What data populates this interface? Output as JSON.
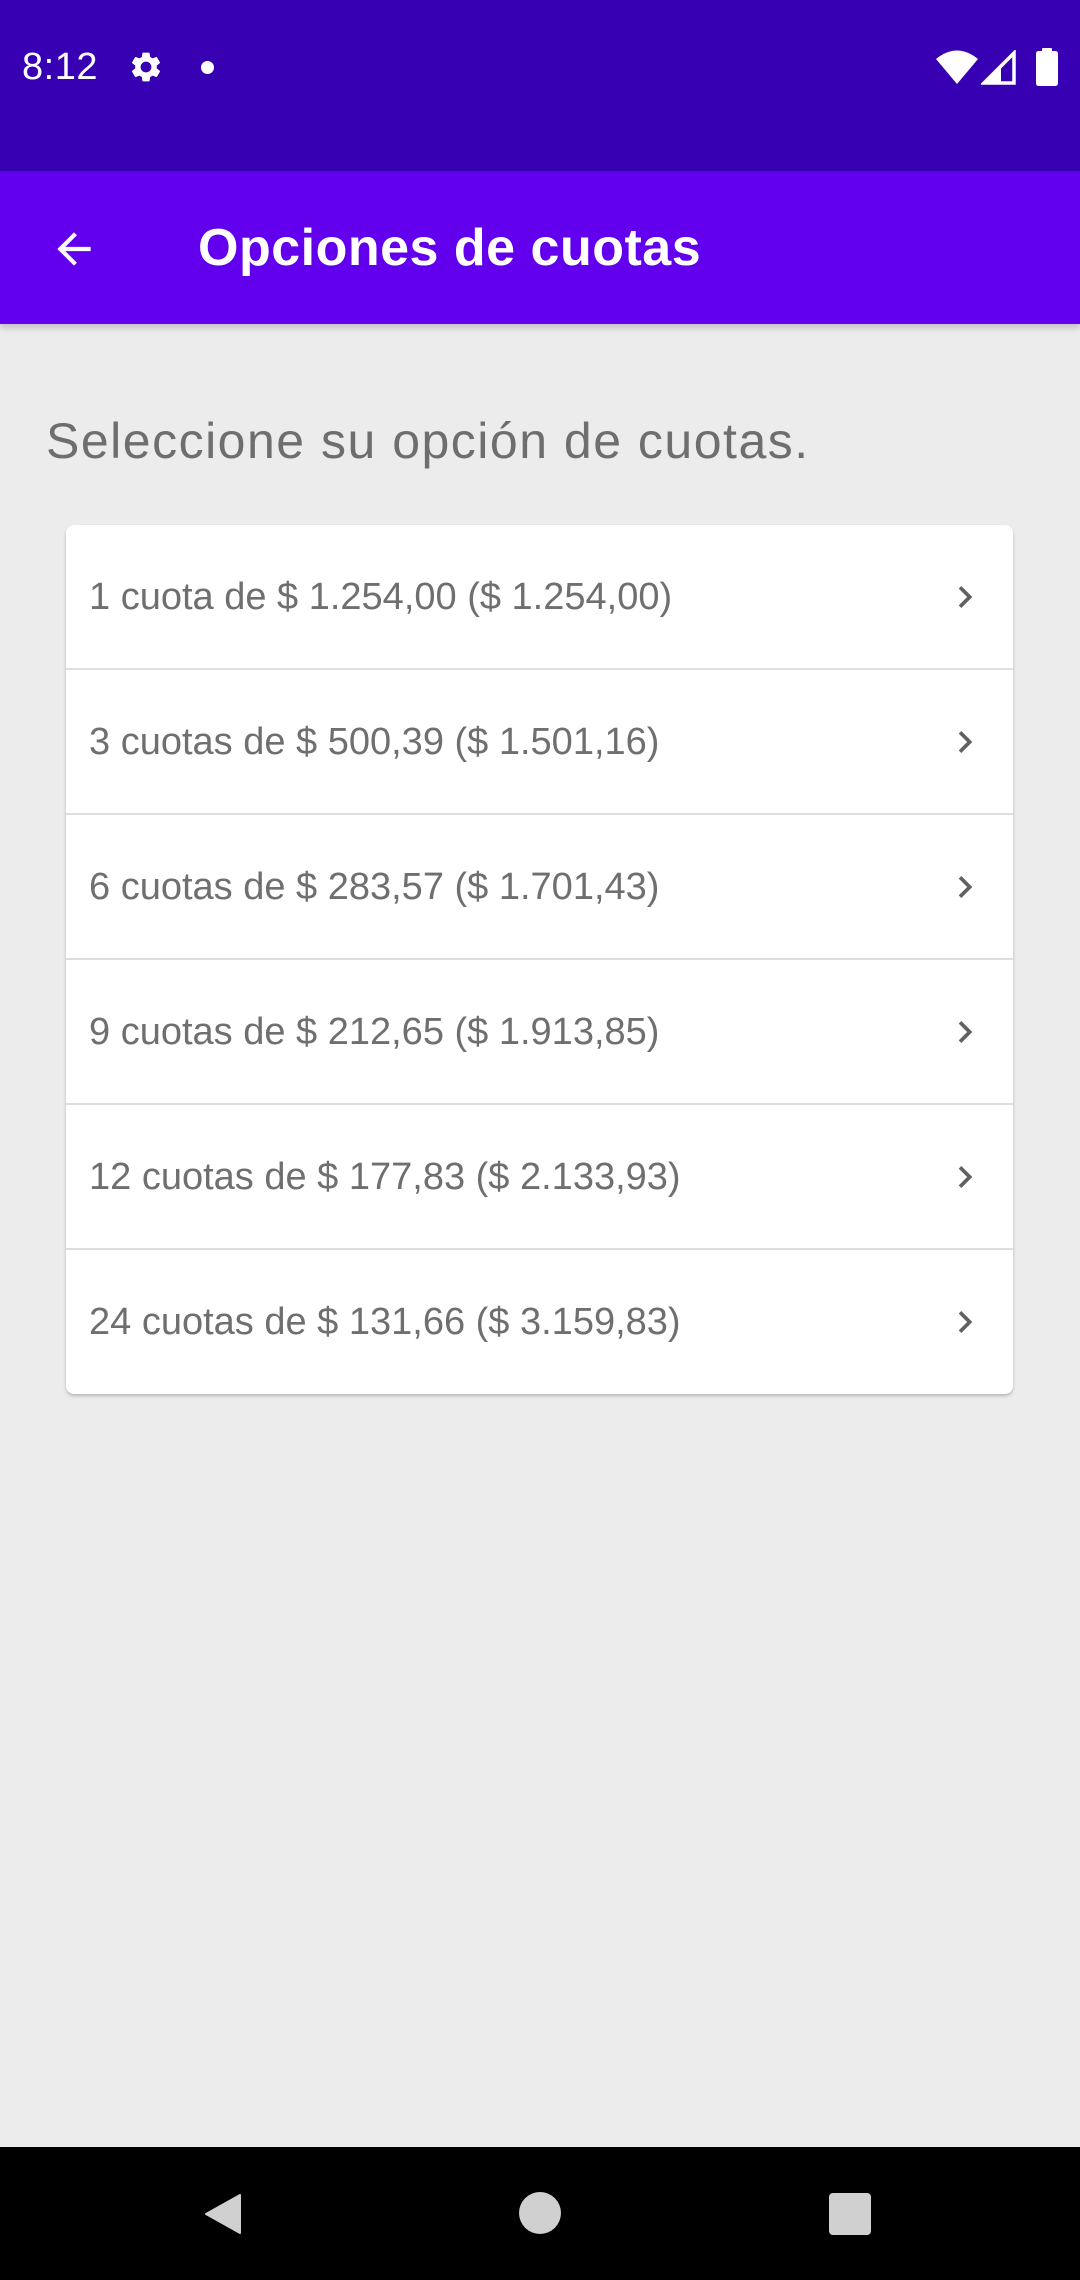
{
  "status_bar": {
    "time": "8:12",
    "icons": [
      "gear-icon",
      "notification-dot-icon",
      "wifi-icon",
      "signal-icon",
      "battery-icon"
    ]
  },
  "app_bar": {
    "title": "Opciones de cuotas",
    "back_icon": "arrow-back-icon"
  },
  "main": {
    "prompt": "Seleccione su opción de cuotas.",
    "options": [
      {
        "label": "1 cuota de $ 1.254,00 ($ 1.254,00)"
      },
      {
        "label": "3 cuotas de $ 500,39 ($ 1.501,16)"
      },
      {
        "label": "6 cuotas de $ 283,57 ($ 1.701,43)"
      },
      {
        "label": "9 cuotas de $ 212,65 ($ 1.913,85)"
      },
      {
        "label": "12 cuotas de $ 177,83 ($ 2.133,93)"
      },
      {
        "label": "24 cuotas de $ 131,66 ($ 3.159,83)"
      }
    ]
  },
  "navigation_bar": {
    "icons": [
      "nav-back-icon",
      "nav-home-icon",
      "nav-recents-icon"
    ]
  },
  "colors": {
    "status_bar": "#3700b3",
    "app_bar": "#6200ee",
    "background": "#ececec",
    "card": "#ffffff",
    "text_secondary": "#6f6f6f"
  }
}
